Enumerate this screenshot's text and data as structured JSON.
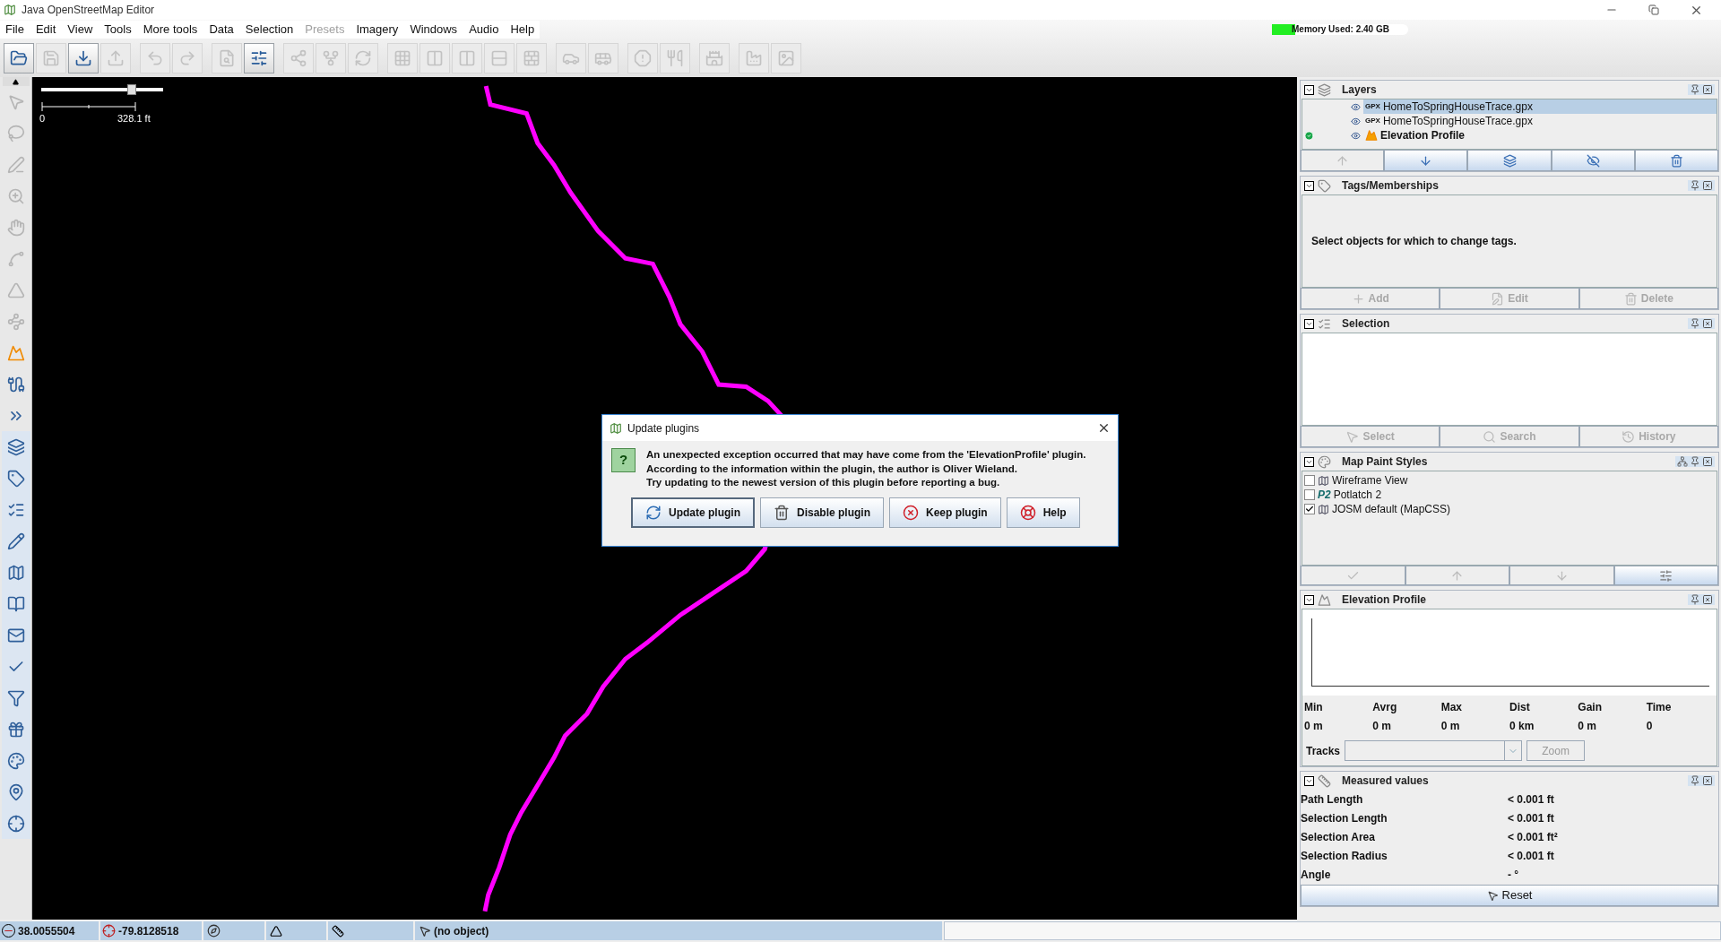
{
  "window": {
    "title": "Java OpenStreetMap Editor"
  },
  "menu": [
    {
      "label": "File",
      "disabled": false
    },
    {
      "label": "Edit",
      "disabled": false
    },
    {
      "label": "View",
      "disabled": false
    },
    {
      "label": "Tools",
      "disabled": false
    },
    {
      "label": "More tools",
      "disabled": false
    },
    {
      "label": "Data",
      "disabled": false
    },
    {
      "label": "Selection",
      "disabled": false
    },
    {
      "label": "Presets",
      "disabled": true
    },
    {
      "label": "Imagery",
      "disabled": false
    },
    {
      "label": "Windows",
      "disabled": false
    },
    {
      "label": "Audio",
      "disabled": false
    },
    {
      "label": "Help",
      "disabled": false
    }
  ],
  "toolbar": {
    "buttons": [
      {
        "disabled": false
      },
      {
        "disabled": true
      },
      {
        "disabled": false
      },
      {
        "disabled": true
      },
      {
        "disabled": true
      },
      {
        "disabled": true
      },
      {
        "disabled": true
      },
      {
        "disabled": false
      },
      {
        "disabled": true
      },
      {
        "disabled": true
      },
      {
        "disabled": true
      },
      {
        "disabled": true
      },
      {
        "disabled": true
      },
      {
        "disabled": true
      },
      {
        "disabled": true
      },
      {
        "disabled": true
      },
      {
        "disabled": true
      },
      {
        "disabled": true
      },
      {
        "disabled": true
      },
      {
        "disabled": true
      },
      {
        "disabled": true
      },
      {
        "disabled": true
      },
      {
        "disabled": true
      }
    ]
  },
  "memory": {
    "label": "Memory Used: 2.40 GB",
    "level": 0.17
  },
  "map": {
    "zoom_slider": {
      "level": 0.74
    },
    "scale": {
      "start": "0",
      "end": "328.1 ft"
    }
  },
  "dialog": {
    "title": "Update plugins",
    "icon_glyph": "?",
    "message": [
      "An unexpected exception occurred that may have come from the 'ElevationProfile' plugin.",
      "According to the information within the plugin, the author is Oliver Wieland.",
      "Try updating to the newest version of this plugin before reporting a bug."
    ],
    "buttons": [
      {
        "label": "Update plugin",
        "focused": true
      },
      {
        "label": "Disable plugin",
        "focused": false
      },
      {
        "label": "Keep plugin",
        "focused": false
      },
      {
        "label": "Help",
        "focused": false
      }
    ]
  },
  "layers": {
    "title": "Layers",
    "items": [
      {
        "tag": "GPX",
        "name": "HomeToSpringHouseTrace.gpx",
        "selected": true,
        "active": false,
        "visible": true,
        "kind": "gpx"
      },
      {
        "tag": "GPX",
        "name": "HomeToSpringHouseTrace.gpx",
        "selected": false,
        "active": false,
        "visible": true,
        "kind": "gpx"
      },
      {
        "name": "Elevation Profile",
        "selected": false,
        "active": true,
        "visible": true,
        "kind": "profile"
      }
    ],
    "buttons": [
      {
        "disabled": true
      },
      {
        "disabled": false
      },
      {
        "disabled": false
      },
      {
        "disabled": false
      },
      {
        "disabled": false
      }
    ]
  },
  "tags": {
    "title": "Tags/Memberships",
    "message": "Select objects for which to change tags.",
    "buttons": [
      {
        "label": "Add",
        "disabled": true
      },
      {
        "label": "Edit",
        "disabled": true
      },
      {
        "label": "Delete",
        "disabled": true
      }
    ]
  },
  "selection": {
    "title": "Selection",
    "buttons": [
      {
        "label": "Select",
        "disabled": true
      },
      {
        "label": "Search",
        "disabled": true
      },
      {
        "label": "History",
        "disabled": true
      }
    ]
  },
  "map_paint_styles": {
    "title": "Map Paint Styles",
    "items": [
      {
        "name": "Wireframe View",
        "checked": false
      },
      {
        "badge": "P2",
        "name": "Potlatch 2",
        "checked": false
      },
      {
        "name": "JOSM default (MapCSS)",
        "checked": true
      }
    ],
    "buttons": [
      {
        "disabled": true
      },
      {
        "disabled": true
      },
      {
        "disabled": true
      },
      {
        "disabled": false
      }
    ]
  },
  "elevation_profile": {
    "title": "Elevation Profile",
    "stats": [
      {
        "label": "Min",
        "value": "0 m"
      },
      {
        "label": "Avrg",
        "value": "0 m"
      },
      {
        "label": "Max",
        "value": "0 m"
      },
      {
        "label": "Dist",
        "value": "0 km"
      },
      {
        "label": "Gain",
        "value": "0 m"
      },
      {
        "label": "Time",
        "value": "0"
      }
    ],
    "tracks_label": "Tracks",
    "zoom_button": {
      "label": "Zoom",
      "disabled": true
    }
  },
  "measured_values": {
    "title": "Measured values",
    "rows": [
      {
        "label": "Path Length",
        "value": "< 0.001 ft"
      },
      {
        "label": "Selection Length",
        "value": "< 0.001 ft"
      },
      {
        "label": "Selection Area",
        "value": "< 0.001 ft²"
      },
      {
        "label": "Selection Radius",
        "value": "< 0.001 ft"
      },
      {
        "label": "Angle",
        "value": "- °"
      }
    ],
    "reset": "Reset"
  },
  "status_bar": {
    "latitude": "38.0055504",
    "longitude": "-79.8128518",
    "object": "(no object)"
  }
}
